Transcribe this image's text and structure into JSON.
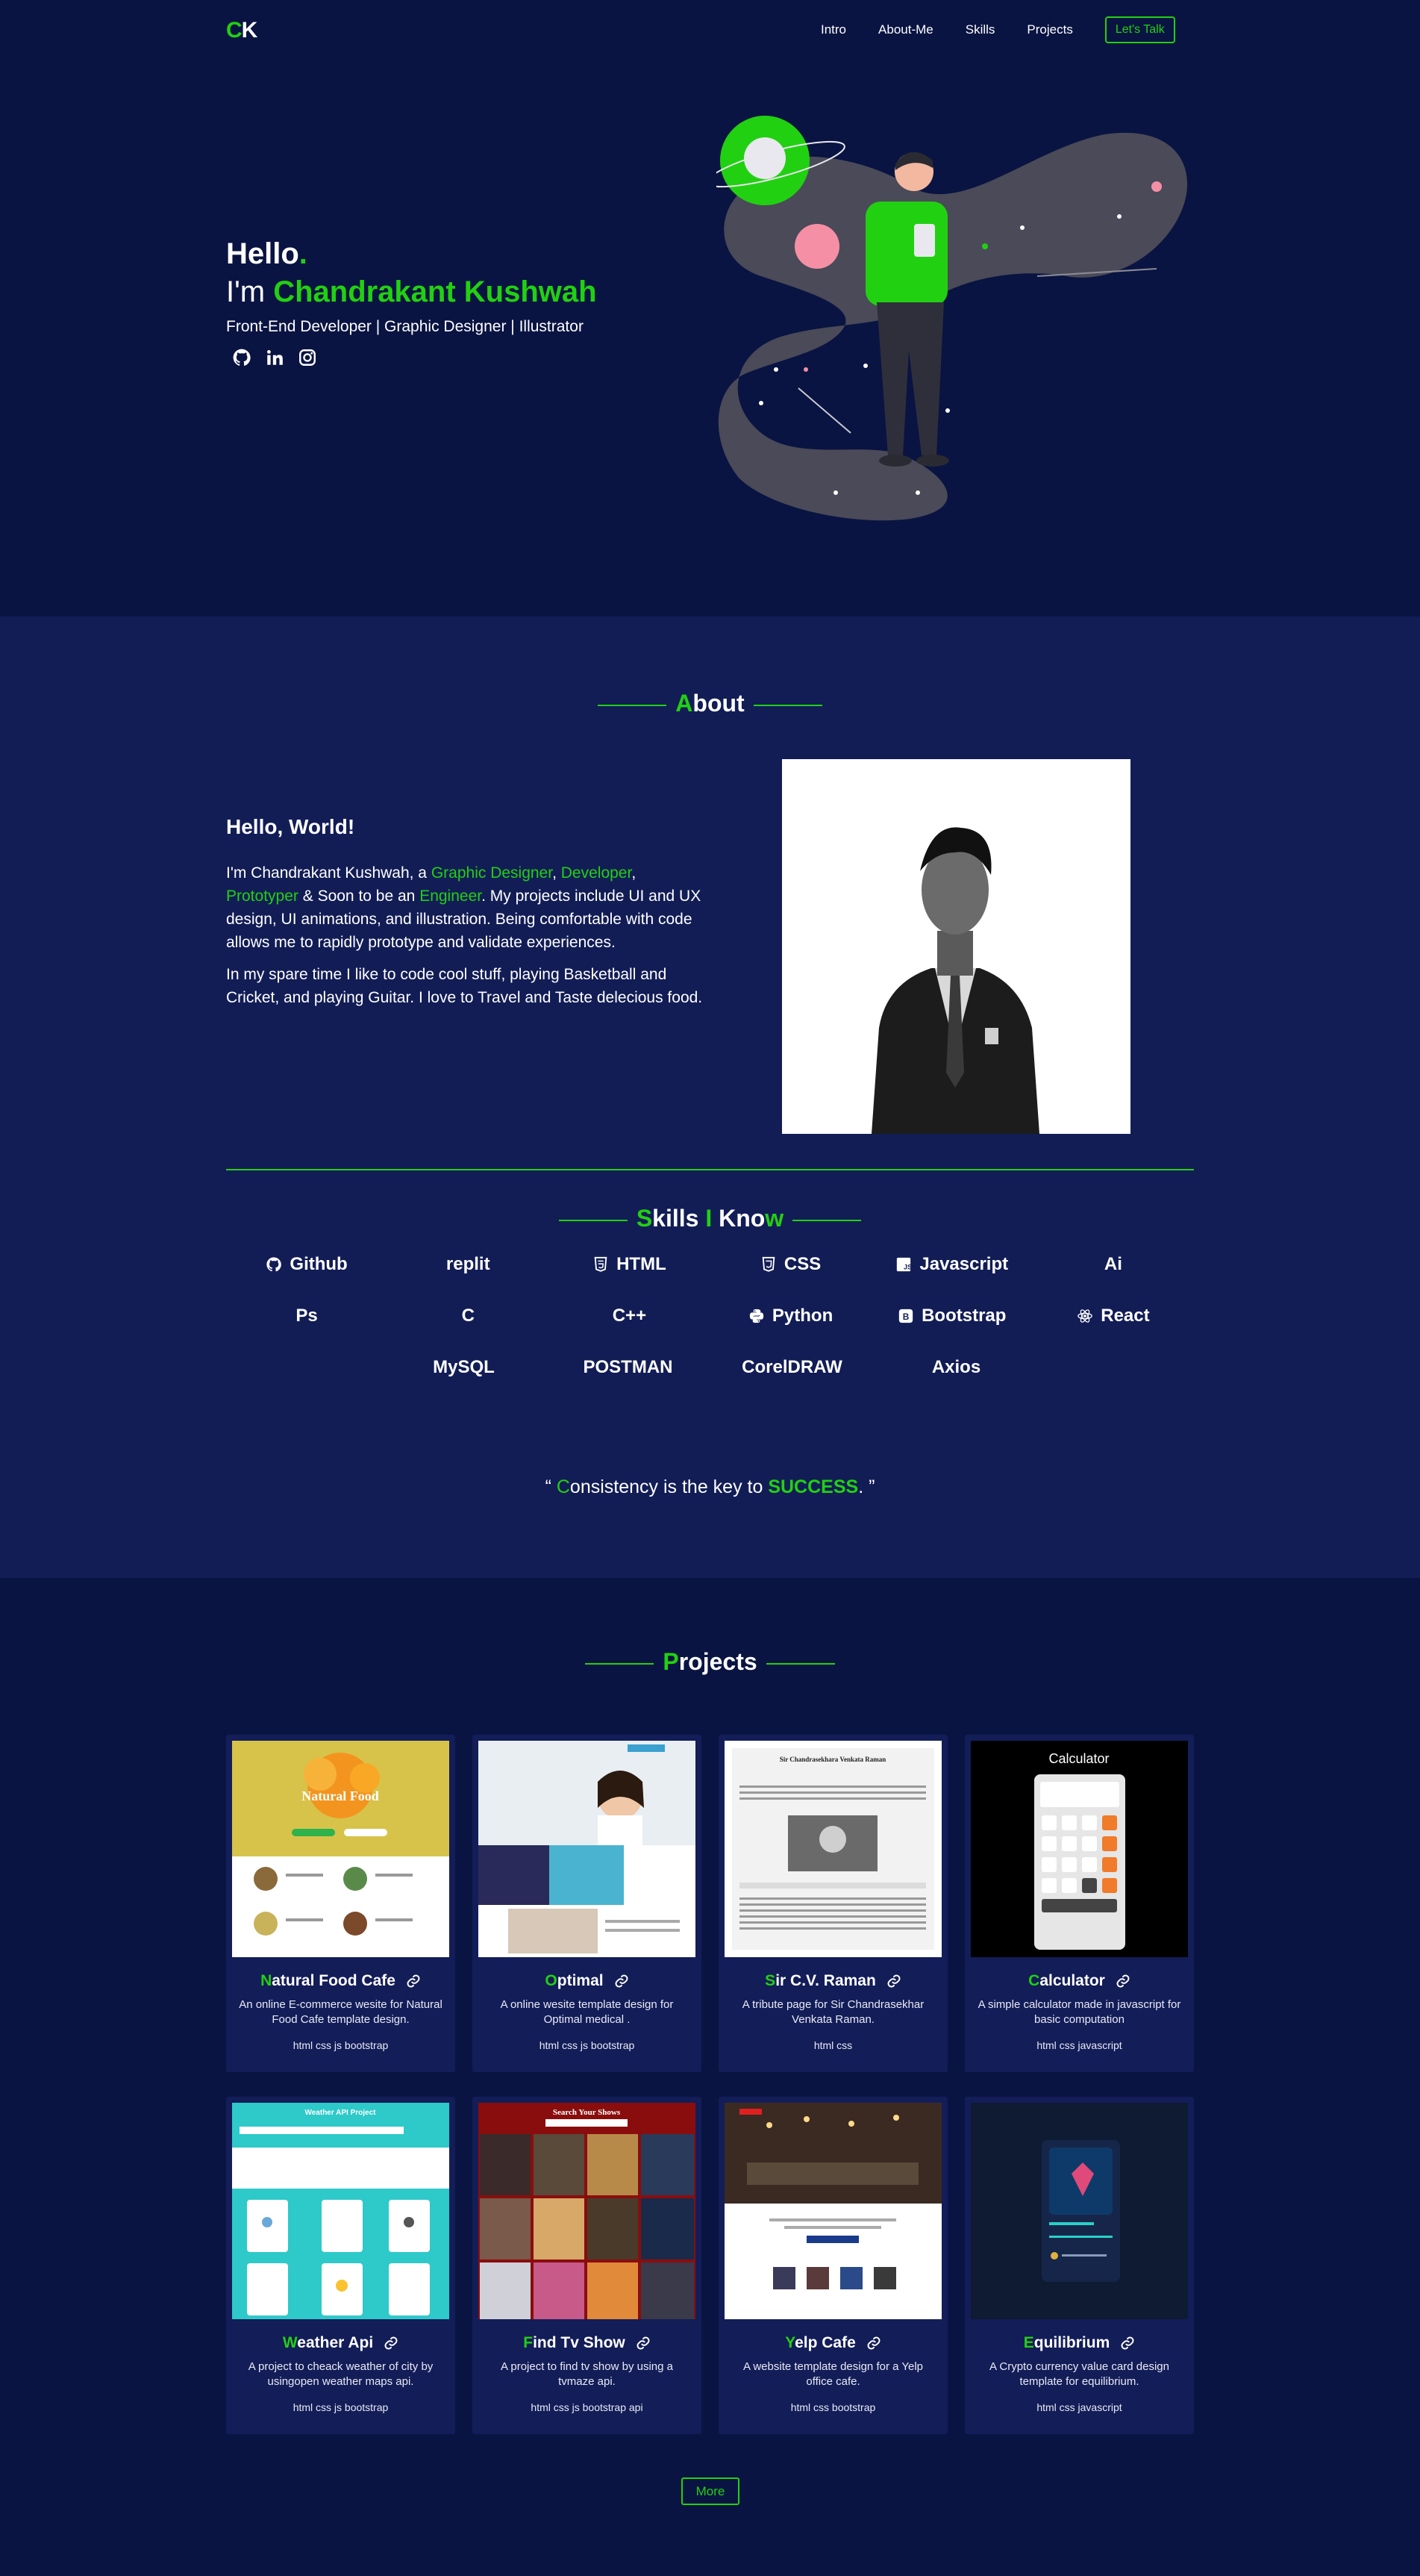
{
  "nav": {
    "logo_first": "C",
    "logo_second": "K",
    "links": [
      "Intro",
      "About-Me",
      "Skills",
      "Projects"
    ],
    "cta": "Let's Talk"
  },
  "hero": {
    "hello": "Hello",
    "hello_dot": ".",
    "im": "I'm ",
    "name": "Chandrakant Kushwah",
    "roles": "Front-End Developer | Graphic Designer | Illustrator",
    "socials": [
      "github-icon",
      "linkedin-icon",
      "instagram-icon"
    ]
  },
  "about": {
    "title_first": "A",
    "title_rest": "bout",
    "heading": "Hello, World!",
    "p1_a": "I'm Chandrakant Kushwah, a ",
    "p1_role1": "Graphic Designer",
    "p1_b": ", ",
    "p1_role2": "Developer",
    "p1_c": ", ",
    "p1_role3": "Prototyper",
    "p1_d": " & Soon to be an ",
    "p1_role4": "Engineer",
    "p1_e": ". My projects include UI and UX design, UI animations, and illustration. Being comfortable with code allows me to rapidly prototype and validate experiences.",
    "p2": "In my spare time I like to code cool stuff, playing Basketball and Cricket, and playing Guitar. I love to Travel and Taste delecious food."
  },
  "skills": {
    "title_s": "S",
    "title_kills": "kills ",
    "title_i": "I",
    "title_kno": " Kno",
    "title_w": "w",
    "rows": [
      [
        {
          "label": "Github",
          "icon": "github-icon"
        },
        {
          "label": "replit",
          "icon": ""
        },
        {
          "label": "HTML",
          "icon": "html5-icon"
        },
        {
          "label": "CSS",
          "icon": "css3-icon"
        },
        {
          "label": "Javascript",
          "icon": "js-icon"
        },
        {
          "label": "Ai",
          "icon": ""
        }
      ],
      [
        {
          "label": "Ps",
          "icon": ""
        },
        {
          "label": "C",
          "icon": ""
        },
        {
          "label": "C++",
          "icon": ""
        },
        {
          "label": "Python",
          "icon": "python-icon"
        },
        {
          "label": "Bootstrap",
          "icon": "bootstrap-icon"
        },
        {
          "label": "React",
          "icon": "react-icon"
        }
      ],
      [
        {
          "label": "MySQL",
          "icon": ""
        },
        {
          "label": "POSTMAN",
          "icon": ""
        },
        {
          "label": "CorelDRAW",
          "icon": ""
        },
        {
          "label": "Axios",
          "icon": ""
        }
      ]
    ],
    "quote_open": "“ ",
    "quote_c": "C",
    "quote_mid": "onsistency is the key to ",
    "quote_success": "SUCCESS",
    "quote_close": ". ”"
  },
  "projects": {
    "title_first": "P",
    "title_rest": "rojects",
    "cards": [
      {
        "first": "N",
        "rest": "atural Food Cafe",
        "desc": "An online E-commerce wesite for Natural Food Cafe template design.",
        "tech": "html css js bootstrap",
        "thumb": "food"
      },
      {
        "first": "O",
        "rest": "ptimal",
        "desc": "A online wesite template design for Optimal medical .",
        "tech": "html css js bootstrap",
        "thumb": "medical"
      },
      {
        "first": "S",
        "rest": "ir C.V. Raman",
        "desc": "A tribute page for Sir Chandrasekhar Venkata Raman.",
        "tech": "html css",
        "thumb": "tribute"
      },
      {
        "first": "C",
        "rest": "alculator",
        "desc": "A simple calculator made in javascript for basic computation",
        "tech": "html css javascript",
        "thumb": "calc"
      },
      {
        "first": "W",
        "rest": "eather Api",
        "desc": "A project to cheack weather of city by usingopen weather maps api.",
        "tech": "html css js bootstrap",
        "thumb": "weather"
      },
      {
        "first": "F",
        "rest": "ind Tv Show",
        "desc": "A project to find tv show by using a tvmaze api.",
        "tech": "html css js bootstrap api",
        "thumb": "tv"
      },
      {
        "first": "Y",
        "rest": "elp Cafe",
        "desc": "A website template design for a Yelp office cafe.",
        "tech": "html css bootstrap",
        "thumb": "yelp"
      },
      {
        "first": "E",
        "rest": "quilibrium",
        "desc": "A Crypto currency value card design template for equilibrium.",
        "tech": "html css javascript",
        "thumb": "equil"
      }
    ],
    "thumb_text": {
      "food": "Natural Food",
      "tribute": "Sir Chandrasekhara Venkata Raman",
      "calc": "Calculator",
      "weather": "Weather API Project",
      "tv": "Search Your Shows"
    },
    "more": "More"
  },
  "colors": {
    "accent": "#22d012",
    "bg": "#0a1442",
    "bg_alt": "#121d56",
    "card": "#131d58"
  }
}
